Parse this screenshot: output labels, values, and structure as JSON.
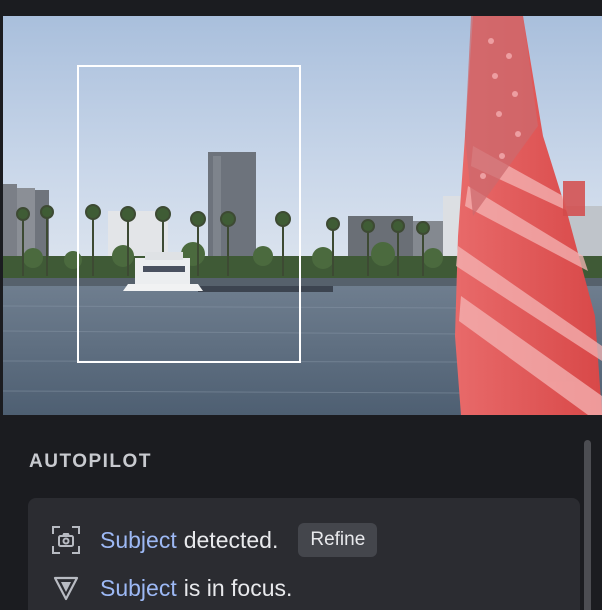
{
  "autopilot": {
    "title": "AUTOPILOT",
    "detection": {
      "icon": "camera-subject-icon",
      "subject_label": "Subject",
      "status_text": "detected.",
      "refine_label": "Refine"
    },
    "focus": {
      "icon": "focus-triangle-icon",
      "subject_label": "Subject",
      "status_text": "is in focus."
    }
  },
  "colors": {
    "accent": "#9db9f5",
    "panel_bg": "#1b1c20",
    "card_bg": "#2b2c31",
    "button_bg": "#44464c"
  }
}
